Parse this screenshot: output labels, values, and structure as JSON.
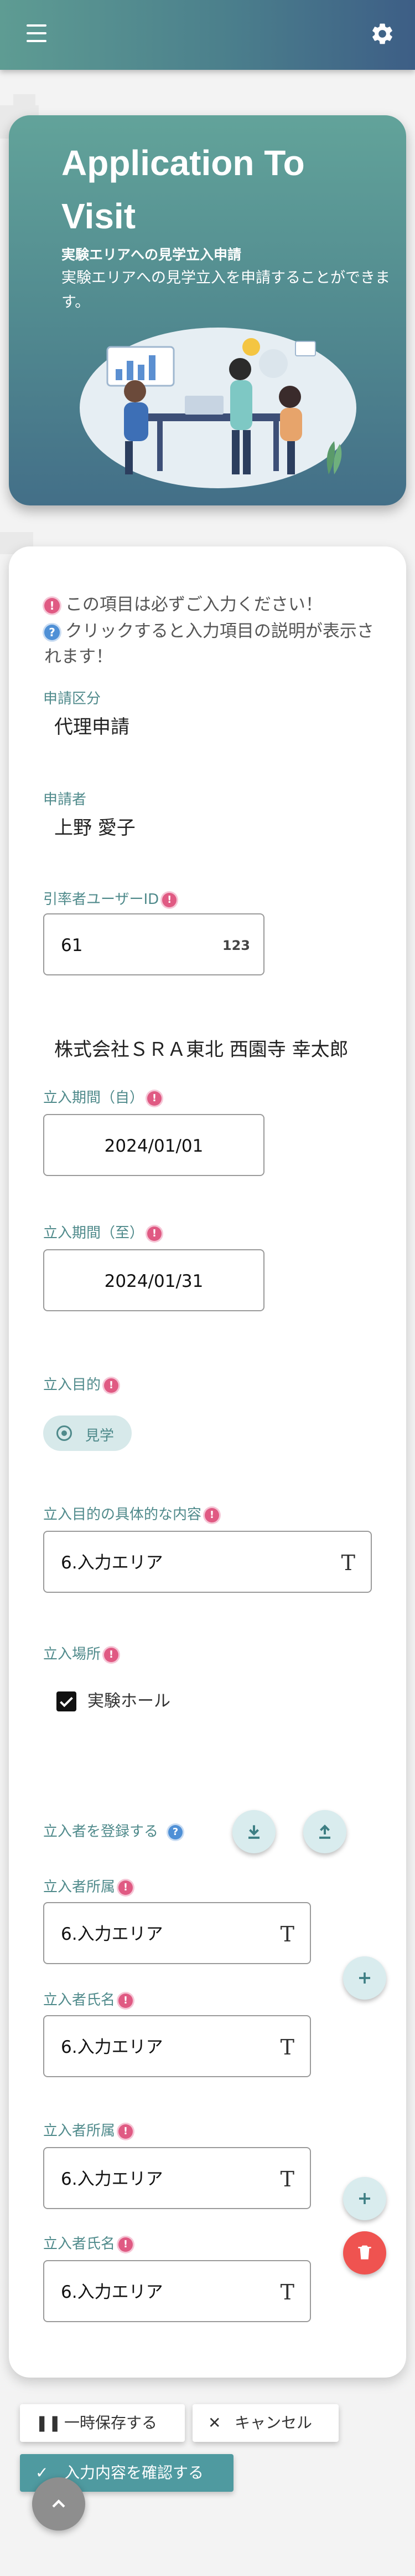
{
  "hero": {
    "title": "Application To Visit",
    "subtitle": "実験エリアへの見学立入申請",
    "description": "実験エリアへの見学立入を申請することができます。"
  },
  "form": {
    "notes": {
      "required": "この項目は必ずご入力ください！",
      "help": "クリックすると入力項目の説明が表示されます！"
    },
    "application_type": {
      "label": "申請区分",
      "value": "代理申請"
    },
    "applicant": {
      "label": "申請者",
      "value": "上野 愛子"
    },
    "leader_id": {
      "label": "引率者ユーザーID",
      "value": "61",
      "badge": "123"
    },
    "leader_name": "株式会社ＳＲＡ東北 西園寺 幸太郎",
    "period_from": {
      "label": "立入期間（自）",
      "value": "2024/01/01"
    },
    "period_to": {
      "label": "立入期間（至）",
      "value": "2024/01/31"
    },
    "purpose": {
      "label": "立入目的",
      "option": "見学"
    },
    "purpose_detail": {
      "label": "立入目的の具体的な内容",
      "value": "6.入力エリア"
    },
    "place": {
      "label": "立入場所",
      "option": "実験ホール"
    },
    "register_visitors": {
      "label": "立入者を登録する"
    },
    "visitors": [
      {
        "affiliation_label": "立入者所属",
        "affiliation_value": "6.入力エリア",
        "name_label": "立入者氏名",
        "name_value": "6.入力エリア"
      },
      {
        "affiliation_label": "立入者所属",
        "affiliation_value": "6.入力エリア",
        "name_label": "立入者氏名",
        "name_value": "6.入力エリア"
      }
    ]
  },
  "actions": {
    "save_draft": "一時保存する",
    "cancel": "キャンセル",
    "confirm": "入力内容を確認する"
  },
  "colors": {
    "accent": "#4f9aa0",
    "required": "#e05a83",
    "help": "#4f90d6",
    "delete": "#ef5350"
  }
}
